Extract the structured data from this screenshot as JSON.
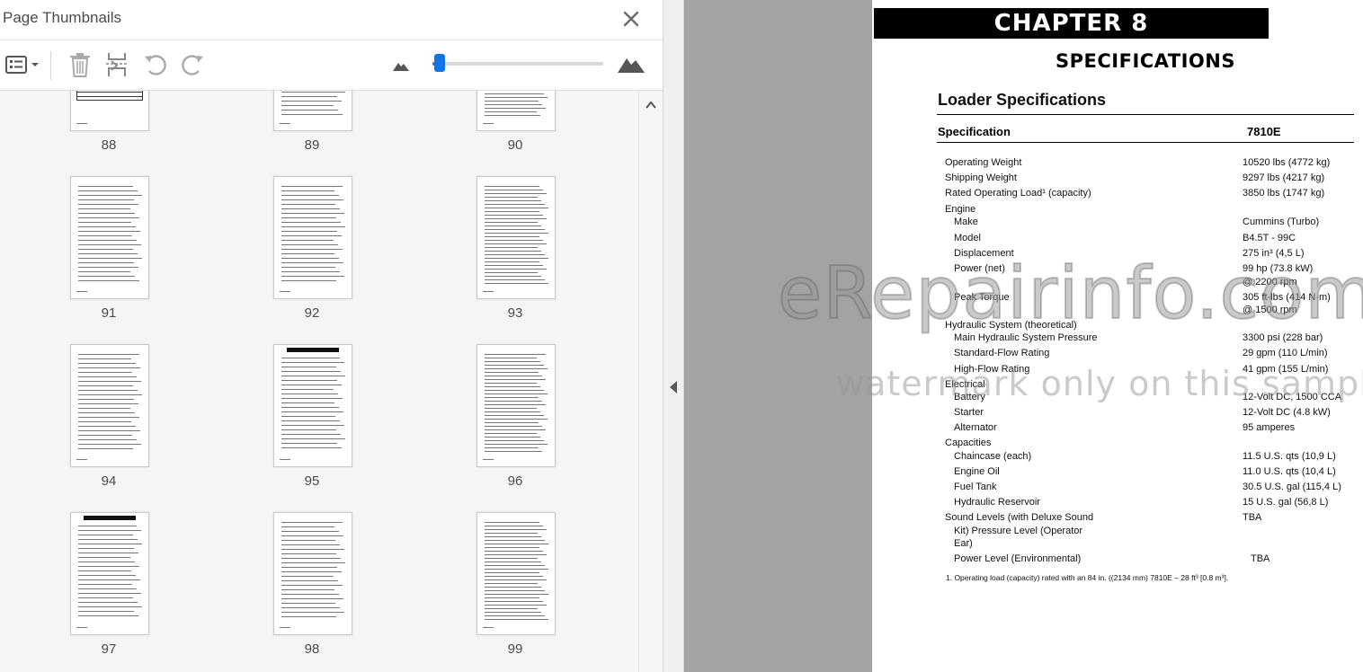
{
  "panel": {
    "title": "Page Thumbnails",
    "zoom_fraction": 0.04
  },
  "icons": {
    "close": "close-icon",
    "options": "thumbnail-options-icon",
    "delete": "trash-icon",
    "insert": "insert-page-icon",
    "undo": "rotate-counterclockwise-icon",
    "redo": "rotate-clockwise-icon",
    "zoom_out": "small-mountain-icon",
    "zoom_in": "large-mountain-icon"
  },
  "thumbnails": [
    {
      "page": "88"
    },
    {
      "page": "89"
    },
    {
      "page": "90"
    },
    {
      "page": "91"
    },
    {
      "page": "92"
    },
    {
      "page": "93"
    },
    {
      "page": "94"
    },
    {
      "page": "95",
      "header": "CHAPTER 9"
    },
    {
      "page": "96"
    },
    {
      "page": "97",
      "header": "INDEX"
    },
    {
      "page": "98"
    },
    {
      "page": "99"
    }
  ],
  "document": {
    "chapter": "CHAPTER 8",
    "subtitle": "SPECIFICATIONS",
    "section": "Loader Specifications",
    "col_spec": "Specification",
    "col_model": "7810E",
    "rows": [
      {
        "label": "Operating Weight",
        "value": "10520 lbs (4772 kg)"
      },
      {
        "label": "Shipping Weight",
        "value": "9297 lbs (4217 kg)"
      },
      {
        "label": "Rated Operating Load¹ (capacity)",
        "value": "3850 lbs (1747 kg)"
      },
      {
        "label": "Engine",
        "value": ""
      },
      {
        "label": "Make",
        "value": "Cummins (Turbo)"
      },
      {
        "label": "Model",
        "value": "B4.5T - 99C"
      },
      {
        "label": "Displacement",
        "value": "275 in³ (4,5 L)"
      },
      {
        "label": "Power (net)",
        "value": "99 hp (73.8 kW)"
      },
      {
        "label": "",
        "value": "@ 2200 rpm"
      },
      {
        "label": "Peak Torque",
        "value": "305 ft-lbs (414 N·m)"
      },
      {
        "label": "",
        "value": "@ 1500 rpm"
      },
      {
        "label": "Hydraulic System (theoretical)",
        "value": ""
      },
      {
        "label": "Main Hydraulic System Pressure",
        "value": "3300 psi (228 bar)"
      },
      {
        "label": "Standard-Flow Rating",
        "value": "29 gpm (110 L/min)"
      },
      {
        "label": "High-Flow Rating",
        "value": "41 gpm (155 L/min)"
      },
      {
        "label": "Electrical",
        "value": ""
      },
      {
        "label": "Battery",
        "value": "12-Volt DC, 1500 CCA"
      },
      {
        "label": "Starter",
        "value": "12-Volt DC (4.8 kW)"
      },
      {
        "label": "Alternator",
        "value": "95 amperes"
      },
      {
        "label": "Capacities",
        "value": ""
      },
      {
        "label": "Chaincase (each)",
        "value": "11.5 U.S. qts (10,9 L)"
      },
      {
        "label": "Engine Oil",
        "value": "11.0 U.S. qts (10,4 L)"
      },
      {
        "label": "Fuel Tank",
        "value": "30.5 U.S. gal (115,4 L)"
      },
      {
        "label": "Hydraulic Reservoir",
        "value": "15 U.S. gal (56,8 L)"
      },
      {
        "label": "Sound Levels (with Deluxe Sound",
        "value": "TBA"
      },
      {
        "label": "Kit) Pressure Level (Operator",
        "value": ""
      },
      {
        "label": "Ear)",
        "value": ""
      },
      {
        "label": "Power Level (Environmental)",
        "value": "TBA"
      }
    ],
    "footnote": "1.    Operating load (capacity) rated with an 84 in. ((2134 mm) 7810E – 28 ft³ [0.8 m³]."
  },
  "watermark": {
    "line1": "eRepairinfo.com",
    "line2": "watermark only on this sample"
  }
}
